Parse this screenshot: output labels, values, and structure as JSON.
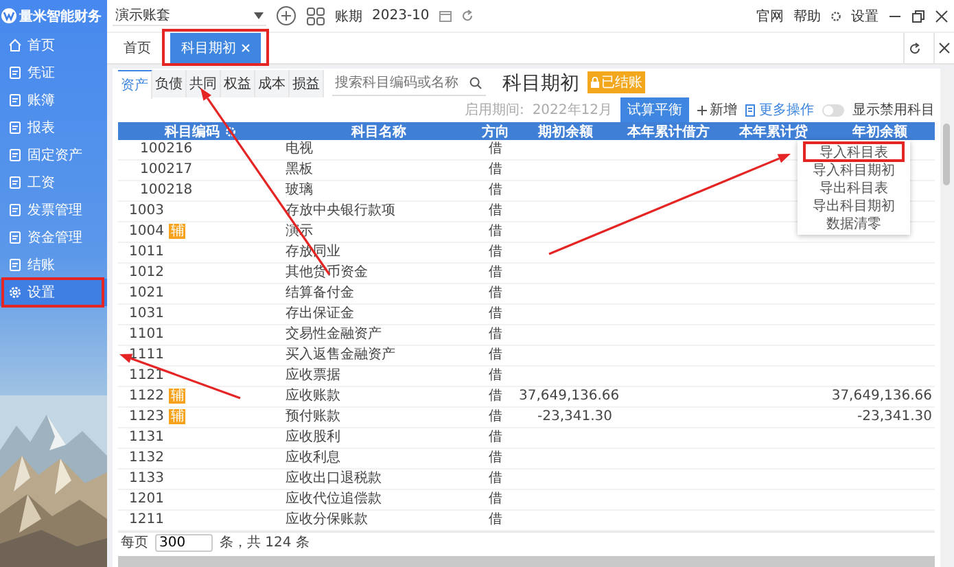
{
  "sidebar": {
    "logo": "量米智能财务",
    "items": [
      {
        "label": "首页",
        "selected": false,
        "marked": false
      },
      {
        "label": "凭证",
        "selected": false,
        "marked": false
      },
      {
        "label": "账簿",
        "selected": false,
        "marked": false
      },
      {
        "label": "报表",
        "selected": false,
        "marked": false
      },
      {
        "label": "固定资产",
        "selected": false,
        "marked": false
      },
      {
        "label": "工资",
        "selected": false,
        "marked": false
      },
      {
        "label": "发票管理",
        "selected": false,
        "marked": false
      },
      {
        "label": "资金管理",
        "selected": false,
        "marked": false
      },
      {
        "label": "结账",
        "selected": false,
        "marked": false
      },
      {
        "label": "设置",
        "selected": true,
        "marked": true
      }
    ]
  },
  "top_bar": {
    "account_set": "演示账套",
    "period_label": "账期",
    "period": "2023-10",
    "links": [
      "官网",
      "帮助",
      "设置"
    ]
  },
  "page_tabs": [
    {
      "label": "首页",
      "selected": false,
      "marked": false
    },
    {
      "label": "科目期初",
      "selected": true,
      "marked": true
    }
  ],
  "category_tabs": [
    {
      "label": "资产",
      "selected": true
    },
    {
      "label": "负债",
      "selected": false
    },
    {
      "label": "共同",
      "selected": false
    },
    {
      "label": "权益",
      "selected": false
    },
    {
      "label": "成本",
      "selected": false
    },
    {
      "label": "损益",
      "selected": false
    }
  ],
  "search": {
    "placeholder": "搜索科目编码或名称"
  },
  "title": "科目期初",
  "status_badge": "已结账",
  "period_info": {
    "label": "启用期间:",
    "value": "2022年12月"
  },
  "actions": {
    "trial_balance": "试算平衡",
    "add": "新增",
    "more": "更多操作"
  },
  "show_disabled": {
    "label": "显示禁用科目",
    "on": false
  },
  "more_menu": [
    {
      "label": "导入科目表",
      "marked": true
    },
    {
      "label": "导入科目期初",
      "marked": false
    },
    {
      "label": "导出科目表",
      "marked": false
    },
    {
      "label": "导出科目期初",
      "marked": false
    },
    {
      "label": "数据清零",
      "marked": false
    }
  ],
  "table": {
    "columns": [
      "科目编码",
      "科目名称",
      "方向",
      "期初余额",
      "本年累计借方",
      "本年累计贷",
      "年初余额"
    ],
    "rows": [
      {
        "kind": "sub",
        "code": "100216",
        "name": "电视",
        "direction": "借"
      },
      {
        "kind": "sub",
        "code": "100217",
        "name": "黑板",
        "direction": "借"
      },
      {
        "kind": "sub",
        "code": "100218",
        "name": "玻璃",
        "direction": "借"
      },
      {
        "kind": "account",
        "code": "1003",
        "name": "存放中央银行款项",
        "direction": "借"
      },
      {
        "kind": "account",
        "code": "1004",
        "tag": "辅",
        "name": "演示",
        "direction": "借"
      },
      {
        "kind": "account",
        "code": "1011",
        "name": "存放同业",
        "direction": "借"
      },
      {
        "kind": "account",
        "code": "1012",
        "name": "其他货币资金",
        "direction": "借"
      },
      {
        "kind": "account",
        "code": "1021",
        "name": "结算备付金",
        "direction": "借"
      },
      {
        "kind": "account",
        "code": "1031",
        "name": "存出保证金",
        "direction": "借"
      },
      {
        "kind": "account",
        "code": "1101",
        "name": "交易性金融资产",
        "direction": "借"
      },
      {
        "kind": "account",
        "code": "1111",
        "name": "买入返售金融资产",
        "direction": "借"
      },
      {
        "kind": "account",
        "code": "1121",
        "name": "应收票据",
        "direction": "借"
      },
      {
        "kind": "account",
        "code": "1122",
        "tag": "辅",
        "name": "应收账款",
        "direction": "借",
        "opening": "37,649,136.66",
        "year_start": "37,649,136.66"
      },
      {
        "kind": "account",
        "code": "1123",
        "tag": "辅",
        "name": "预付账款",
        "direction": "借",
        "opening": "-23,341.30",
        "year_start": "-23,341.30"
      },
      {
        "kind": "account",
        "code": "1131",
        "name": "应收股利",
        "direction": "借"
      },
      {
        "kind": "account",
        "code": "1132",
        "name": "应收利息",
        "direction": "借"
      },
      {
        "kind": "account",
        "code": "1133",
        "name": "应收出口退税款",
        "direction": "借"
      },
      {
        "kind": "account",
        "code": "1201",
        "name": "应收代位追偿款",
        "direction": "借"
      },
      {
        "kind": "account",
        "code": "1211",
        "name": "应收分保账款",
        "direction": "借"
      }
    ]
  },
  "pager": {
    "label": "每页",
    "page_size": "300",
    "total": "条，共 124 条"
  }
}
